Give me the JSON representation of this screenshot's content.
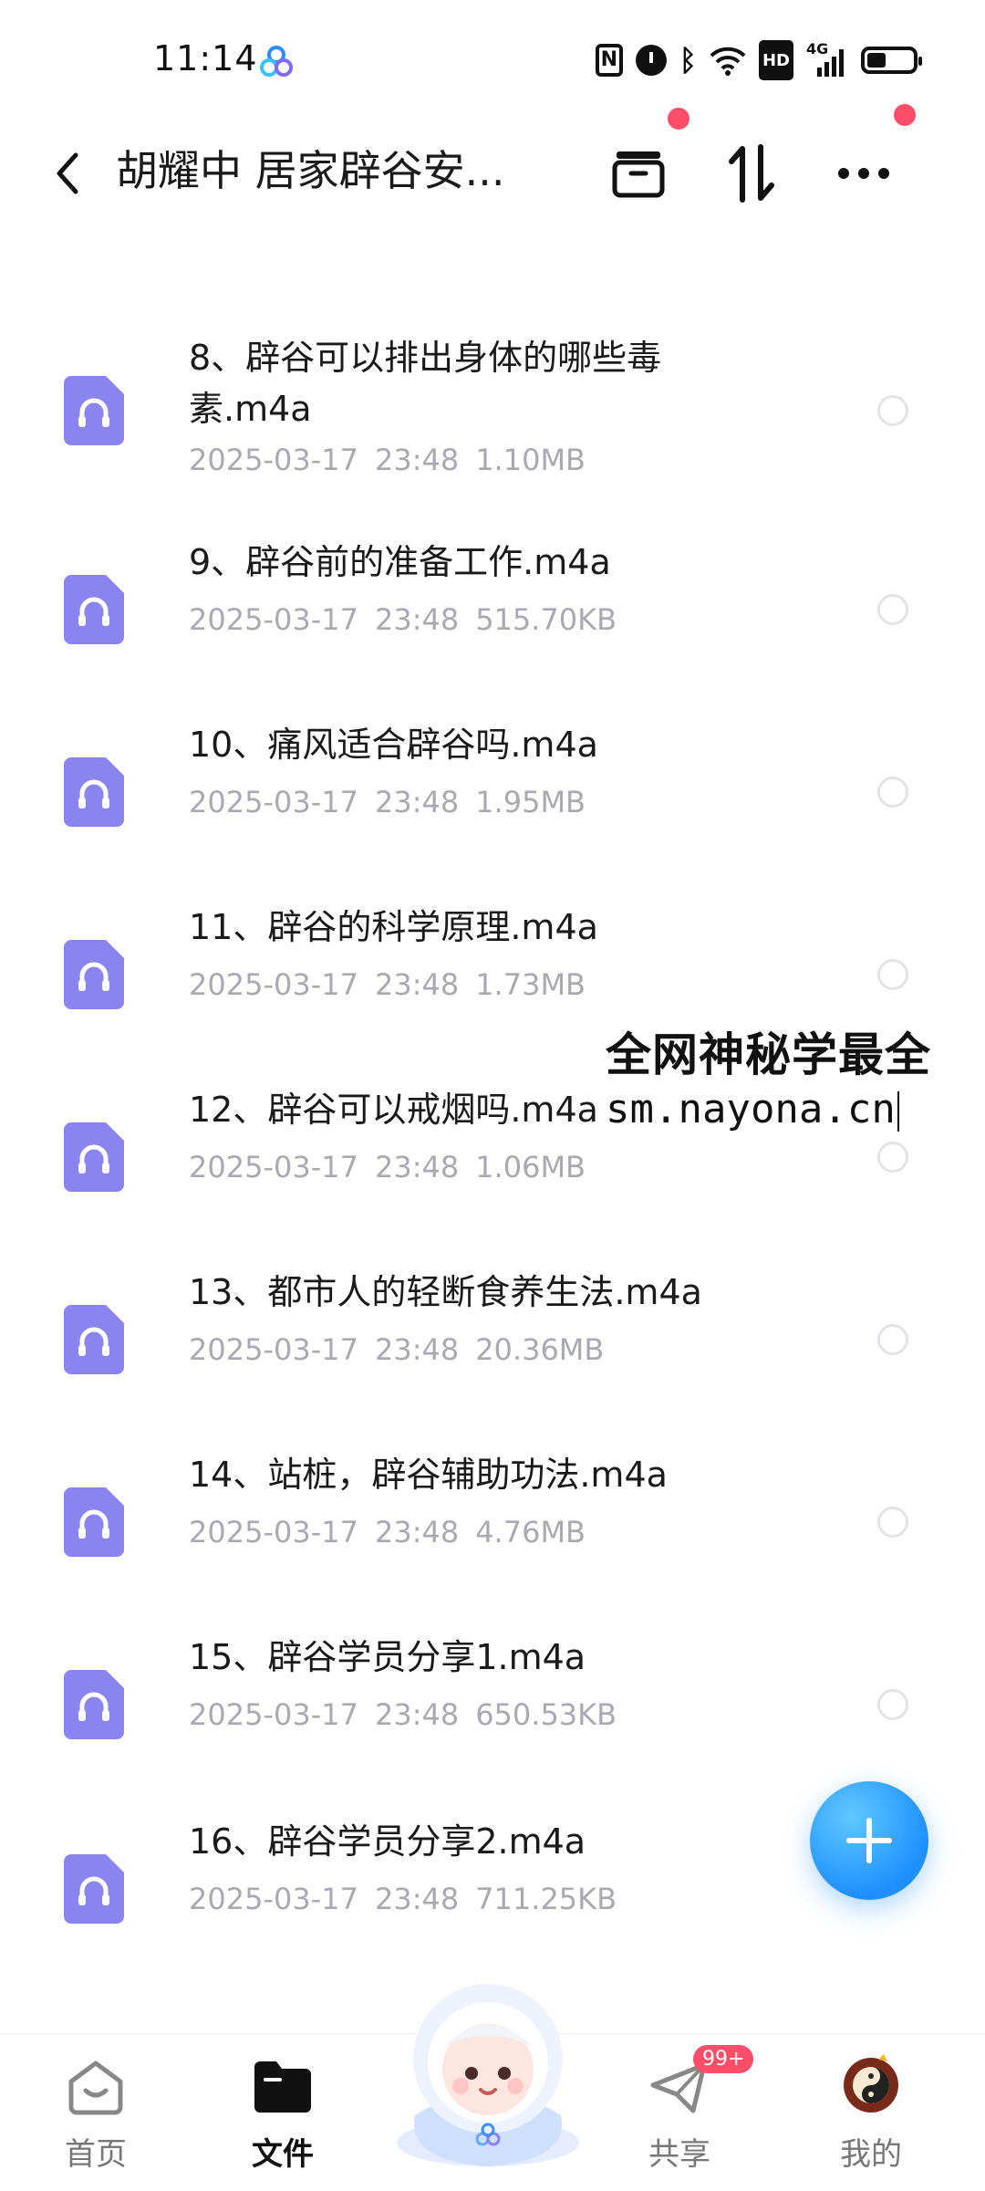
{
  "status_bar": {
    "time": "11:14",
    "icons": [
      "nfc-icon",
      "alarm-icon",
      "bluetooth-icon",
      "wifi-icon",
      "hd-icon",
      "signal-4g-icon",
      "battery-icon"
    ],
    "signal_label": "4G"
  },
  "header": {
    "title": "胡耀中 居家辟谷安..."
  },
  "files": [
    {
      "name": "8、辟谷可以排出身体的哪些毒素.m4a",
      "date": "2025-03-17",
      "time": "23:48",
      "size": "1.10MB"
    },
    {
      "name": "9、辟谷前的准备工作.m4a",
      "date": "2025-03-17",
      "time": "23:48",
      "size": "515.70KB"
    },
    {
      "name": "10、痛风适合辟谷吗.m4a",
      "date": "2025-03-17",
      "time": "23:48",
      "size": "1.95MB"
    },
    {
      "name": "11、辟谷的科学原理.m4a",
      "date": "2025-03-17",
      "time": "23:48",
      "size": "1.73MB"
    },
    {
      "name": "12、辟谷可以戒烟吗.m4a",
      "date": "2025-03-17",
      "time": "23:48",
      "size": "1.06MB"
    },
    {
      "name": "13、都市人的轻断食养生法.m4a",
      "date": "2025-03-17",
      "time": "23:48",
      "size": "20.36MB"
    },
    {
      "name": "14、站桩，辟谷辅助功法.m4a",
      "date": "2025-03-17",
      "time": "23:48",
      "size": "4.76MB"
    },
    {
      "name": "15、辟谷学员分享1.m4a",
      "date": "2025-03-17",
      "time": "23:48",
      "size": "650.53KB"
    },
    {
      "name": "16、辟谷学员分享2.m4a",
      "date": "2025-03-17",
      "time": "23:48",
      "size": "711.25KB"
    }
  ],
  "watermark": {
    "line1": "全网神秘学最全",
    "line2": "sm.nayona.cn"
  },
  "bottom_nav": {
    "items": [
      {
        "label": "首页"
      },
      {
        "label": "文件"
      },
      {
        "label": "共享",
        "badge": "99+"
      },
      {
        "label": "我的"
      }
    ]
  },
  "colors": {
    "accent": "#1f8fff",
    "file_icon": "#8c84ee",
    "meta_text": "#a9a9b1",
    "notification_dot": "#ff4d6a"
  }
}
